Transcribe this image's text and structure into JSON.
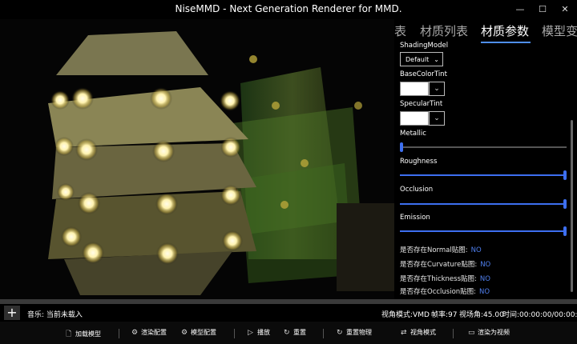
{
  "window": {
    "title": "NiseMMD - Next Generation Renderer for MMD."
  },
  "tabs": [
    "表",
    "材质列表",
    "材质参数",
    "模型变"
  ],
  "material": {
    "shading_model_label": "ShadingModel",
    "shading_model_value": "Default",
    "base_color_label": "BaseColorTint",
    "base_color": "#ffffff",
    "specular_label": "SpecularTint",
    "specular_color": "#ffffff",
    "sliders": [
      {
        "label": "Metallic",
        "value": 0.0
      },
      {
        "label": "Roughness",
        "value": 1.0
      },
      {
        "label": "Occlusion",
        "value": 1.0
      },
      {
        "label": "Emission",
        "value": 1.0
      }
    ],
    "texture_checks": [
      {
        "label": "是否存在Normal贴图:",
        "value": "NO"
      },
      {
        "label": "是否存在Curvature贴图:",
        "value": "NO"
      },
      {
        "label": "是否存在Thickness贴图:",
        "value": "NO"
      },
      {
        "label": "是否存在Occlusion贴图:",
        "value": "NO"
      }
    ]
  },
  "status": {
    "music": "音乐: 当前未载入",
    "view_mode": "视角模式:VMD",
    "fps": "帧率:97",
    "fov": "视场角:45.00",
    "time": "时间:00:00:00/00:00:00"
  },
  "toolbar": {
    "load_model": "加载模型",
    "render_config": "渲染配置",
    "model_config": "模型配置",
    "play": "播放",
    "reset": "重置",
    "reset_physics": "重置物理",
    "view_mode": "视角模式",
    "render_video": "渲染为视频"
  },
  "colors": {
    "accent": "#3d6ff0",
    "background": "#000000"
  }
}
